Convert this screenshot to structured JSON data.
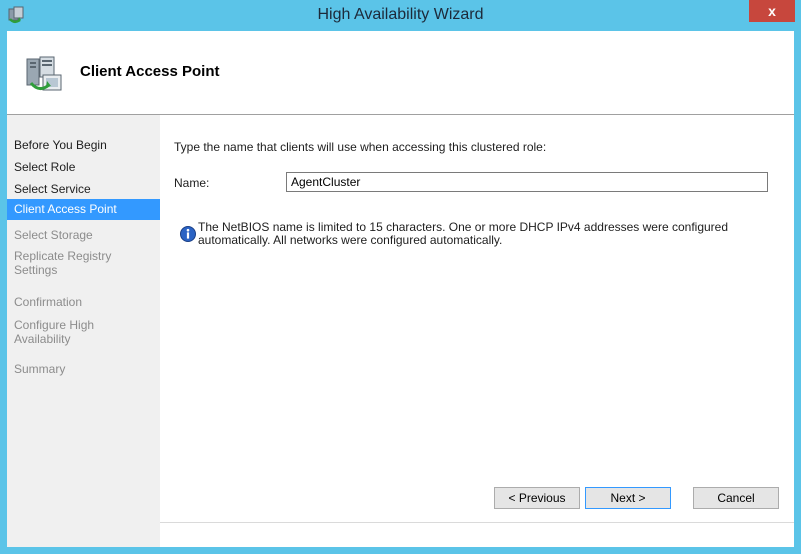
{
  "window": {
    "title": "High Availability Wizard",
    "close_glyph": "x"
  },
  "header": {
    "title": "Client Access Point"
  },
  "nav": {
    "items": [
      {
        "label": "Before You Begin",
        "state": "visited"
      },
      {
        "label": "Select Role",
        "state": "visited"
      },
      {
        "label": "Select Service",
        "state": "visited"
      },
      {
        "label": "Client Access Point",
        "state": "selected"
      },
      {
        "label": "Select Storage",
        "state": "disabled"
      },
      {
        "label": "Replicate Registry Settings",
        "state": "disabled"
      },
      {
        "label": "Confirmation",
        "state": "disabled"
      },
      {
        "label": "Configure High Availability",
        "state": "disabled"
      },
      {
        "label": "Summary",
        "state": "disabled"
      }
    ]
  },
  "main": {
    "prompt": "Type the name that clients will use when accessing this clustered role:",
    "name_label": "Name:",
    "name_value": "AgentCluster",
    "info_text": "The NetBIOS name is limited to 15 characters.  One or more DHCP IPv4 addresses were configured automatically.  All networks were configured automatically."
  },
  "buttons": {
    "previous": "< Previous",
    "next": "Next >",
    "cancel": "Cancel"
  },
  "colors": {
    "frame": "#5bc4e8",
    "close": "#c7473d",
    "selection": "#3399ff"
  },
  "icons": {
    "app": "wizard-app-icon",
    "header": "server-cluster-icon",
    "info": "info-icon"
  }
}
